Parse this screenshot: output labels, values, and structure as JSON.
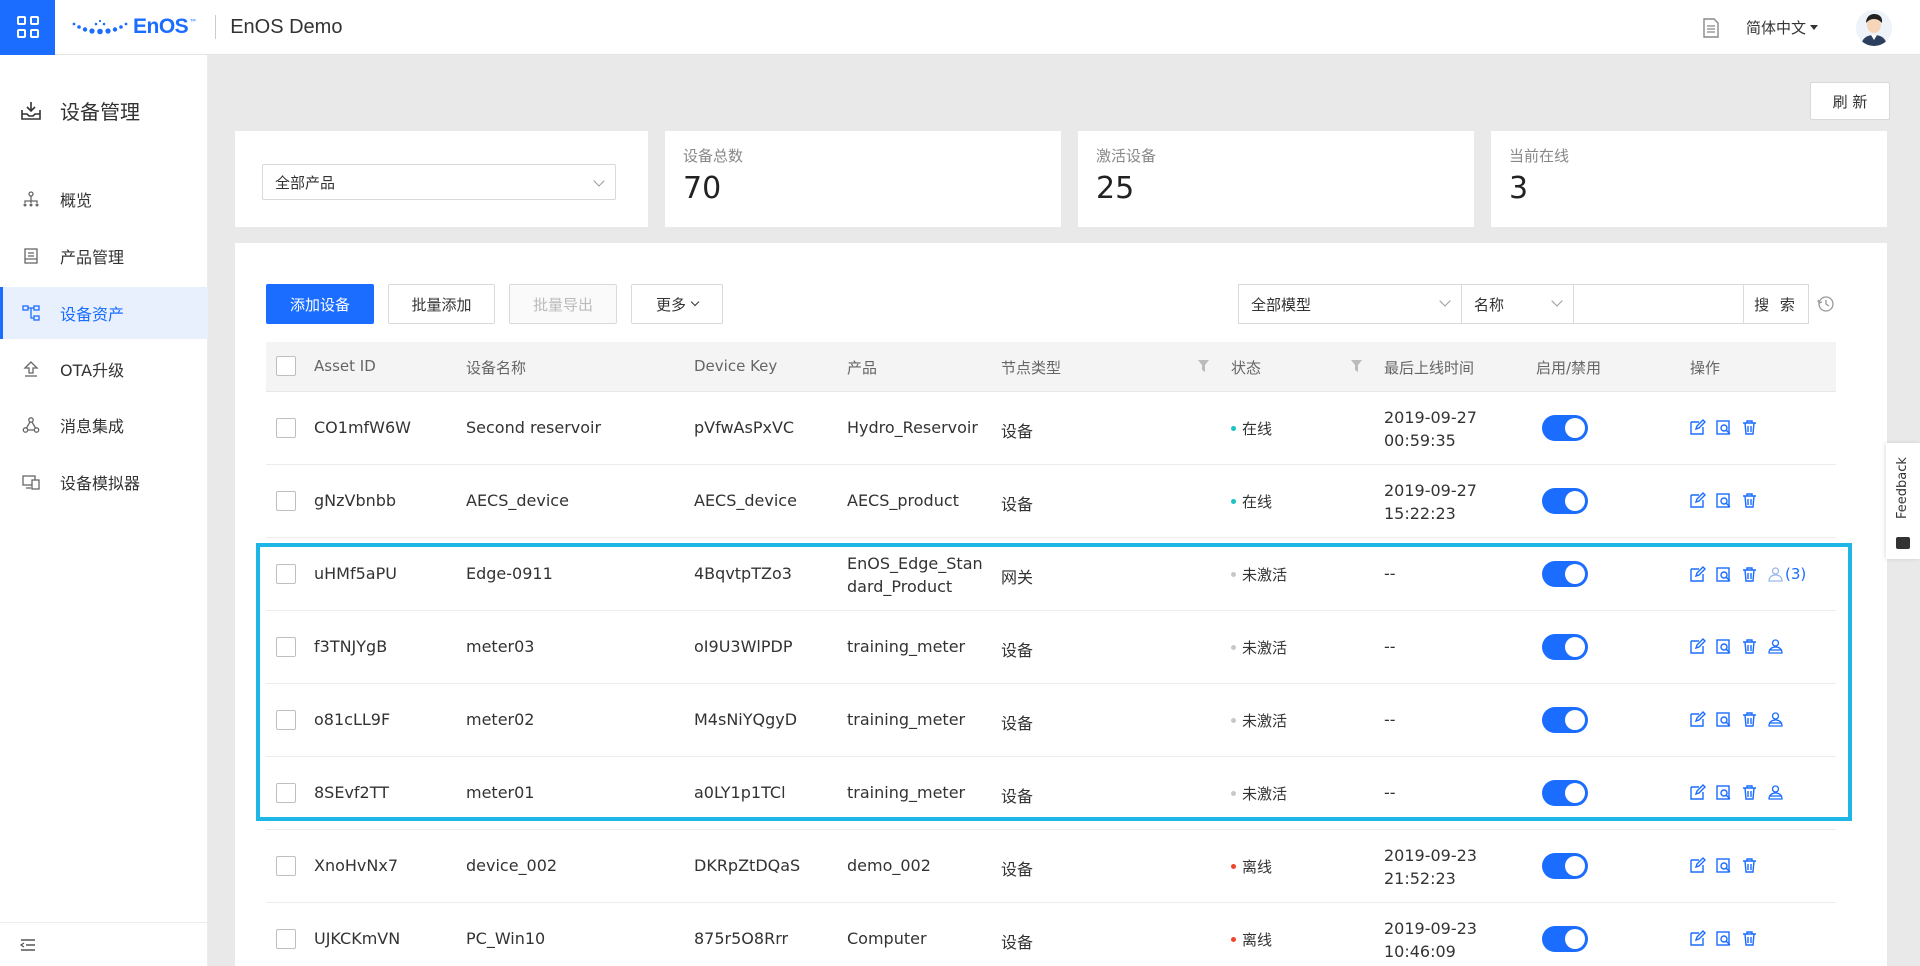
{
  "topbar": {
    "logo_text": "EnOS",
    "logo_tm": "™",
    "app_title": "EnOS Demo",
    "language": "简体中文"
  },
  "sidebar": {
    "title": "设备管理",
    "items": [
      {
        "label": "概览",
        "icon": "hierarchy-icon",
        "active": false
      },
      {
        "label": "产品管理",
        "icon": "product-icon",
        "active": false
      },
      {
        "label": "设备资产",
        "icon": "asset-icon",
        "active": true
      },
      {
        "label": "OTA升级",
        "icon": "upload-icon",
        "active": false
      },
      {
        "label": "消息集成",
        "icon": "share-icon",
        "active": false
      },
      {
        "label": "设备模拟器",
        "icon": "simulator-icon",
        "active": false
      }
    ]
  },
  "toolbar": {
    "refresh_label": "刷 新"
  },
  "stats": {
    "product_filter": "全部产品",
    "total_label": "设备总数",
    "total_value": "70",
    "activated_label": "激活设备",
    "activated_value": "25",
    "online_label": "当前在线",
    "online_value": "3"
  },
  "actions": {
    "add": "添加设备",
    "batch_add": "批量添加",
    "batch_export": "批量导出",
    "more": "更多",
    "model_filter": "全部模型",
    "search_field": "名称",
    "search_value": "",
    "search_button": "搜 索"
  },
  "table": {
    "headers": {
      "asset_id": "Asset ID",
      "name": "设备名称",
      "device_key": "Device Key",
      "product": "产品",
      "node_type": "节点类型",
      "status": "状态",
      "last_online": "最后上线时间",
      "enabled": "启用/禁用",
      "ops": "操作"
    },
    "rows": [
      {
        "asset_id": "CO1mfW6W",
        "name": "Second reservoir",
        "device_key": "pVfwAsPxVC",
        "product": "Hydro_Reservoir",
        "node_type": "设备",
        "status": "在线",
        "status_color": "#19c3c0",
        "last_online": "2019-09-27\n00:59:35",
        "enabled": true
      },
      {
        "asset_id": "gNzVbnbb",
        "name": "AECS_device",
        "device_key": "AECS_device",
        "product": "AECS_product",
        "node_type": "设备",
        "status": "在线",
        "status_color": "#19c3c0",
        "last_online": "2019-09-27\n15:22:23",
        "enabled": true
      },
      {
        "asset_id": "uHMf5aPU",
        "name": "Edge-0911",
        "device_key": "4BqvtpTZo3",
        "product": "EnOS_Edge_Stan\ndard_Product",
        "node_type": "网关",
        "status": "未激活",
        "status_color": "#c8c8c8",
        "last_online": "--",
        "enabled": true,
        "sub_count": "(3)"
      },
      {
        "asset_id": "f3TNJYgB",
        "name": "meter03",
        "device_key": "oI9U3WlPDP",
        "product": "training_meter",
        "node_type": "设备",
        "status": "未激活",
        "status_color": "#c8c8c8",
        "last_online": "--",
        "enabled": true
      },
      {
        "asset_id": "o81cLL9F",
        "name": "meter02",
        "device_key": "M4sNiYQgyD",
        "product": "training_meter",
        "node_type": "设备",
        "status": "未激活",
        "status_color": "#c8c8c8",
        "last_online": "--",
        "enabled": true
      },
      {
        "asset_id": "8SEvf2TT",
        "name": "meter01",
        "device_key": "a0LY1p1TCl",
        "product": "training_meter",
        "node_type": "设备",
        "status": "未激活",
        "status_color": "#c8c8c8",
        "last_online": "--",
        "enabled": true
      },
      {
        "asset_id": "XnoHvNx7",
        "name": "device_002",
        "device_key": "DKRpZtDQaS",
        "product": "demo_002",
        "node_type": "设备",
        "status": "离线",
        "status_color": "#f0442b",
        "last_online": "2019-09-23\n21:52:23",
        "enabled": true
      },
      {
        "asset_id": "UJKCKmVN",
        "name": "PC_Win10",
        "device_key": "875r5O8Rrr",
        "product": "Computer",
        "node_type": "设备",
        "status": "离线",
        "status_color": "#f0442b",
        "last_online": "2019-09-23\n10:46:09",
        "enabled": true
      }
    ]
  },
  "feedback": {
    "label": "Feedback"
  },
  "colors": {
    "accent": "#1a6dff",
    "highlight": "#1eb6e6"
  }
}
